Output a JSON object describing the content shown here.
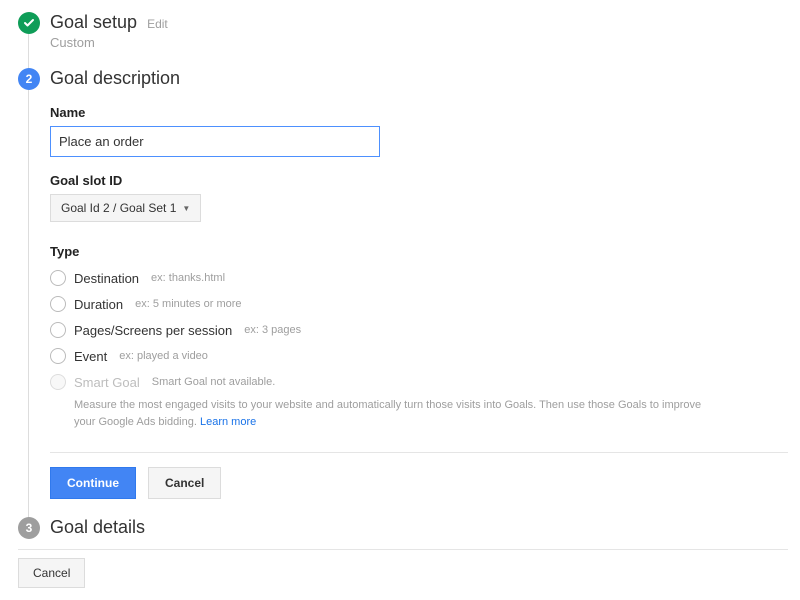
{
  "steps": {
    "setup": {
      "title": "Goal setup",
      "edit": "Edit",
      "subtitle": "Custom"
    },
    "description": {
      "number": "2",
      "title": "Goal description"
    },
    "details": {
      "number": "3",
      "title": "Goal details"
    }
  },
  "form": {
    "name_label": "Name",
    "name_value": "Place an order",
    "slot_label": "Goal slot ID",
    "slot_value": "Goal Id 2 / Goal Set 1",
    "type_label": "Type",
    "types": [
      {
        "label": "Destination",
        "example": "ex: thanks.html"
      },
      {
        "label": "Duration",
        "example": "ex: 5 minutes or more"
      },
      {
        "label": "Pages/Screens per session",
        "example": "ex: 3 pages"
      },
      {
        "label": "Event",
        "example": "ex: played a video"
      }
    ],
    "smart": {
      "label": "Smart Goal",
      "note": "Smart Goal not available.",
      "desc": "Measure the most engaged visits to your website and automatically turn those visits into Goals. Then use those Goals to improve your Google Ads bidding.",
      "learn": "Learn more"
    }
  },
  "buttons": {
    "continue": "Continue",
    "cancel": "Cancel"
  },
  "footer": {
    "cancel": "Cancel"
  }
}
